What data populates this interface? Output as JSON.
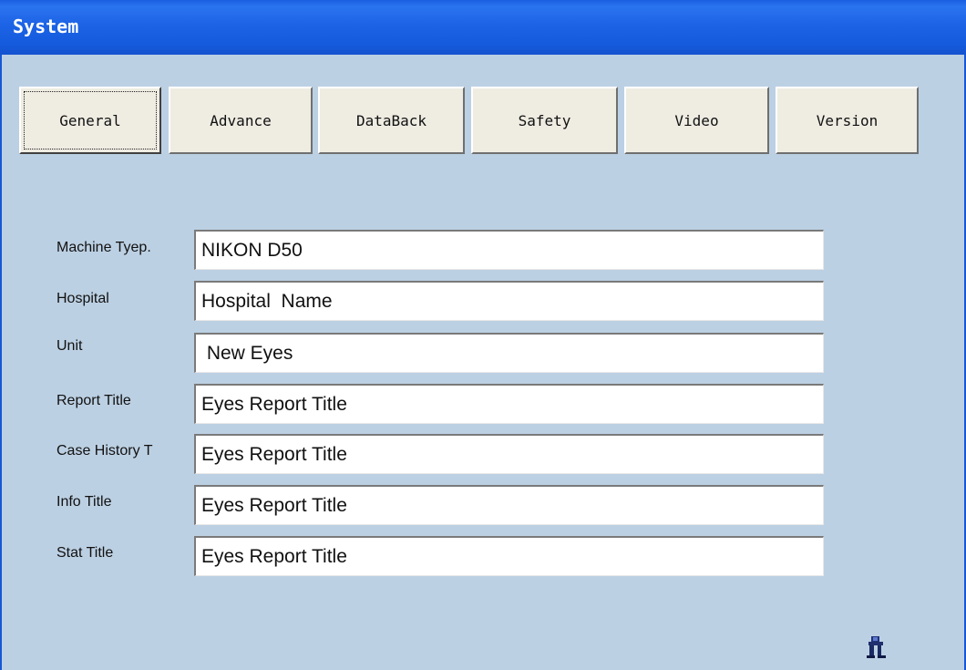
{
  "window": {
    "title": "System"
  },
  "tabs": [
    {
      "label": "General",
      "active": true
    },
    {
      "label": "Advance",
      "active": false
    },
    {
      "label": "DataBack",
      "active": false
    },
    {
      "label": "Safety",
      "active": false
    },
    {
      "label": "Video",
      "active": false
    },
    {
      "label": "Version",
      "active": false
    }
  ],
  "form": {
    "fields": [
      {
        "label": "Machine Tyep.",
        "value": "NIKON D50"
      },
      {
        "label": "Hospital",
        "value": "Hospital  Name"
      },
      {
        "label": "Unit",
        "value": " New Eyes"
      },
      {
        "label": "Report Title",
        "value": "Eyes Report Title"
      },
      {
        "label": "Case History T",
        "value": "Eyes Report Title"
      },
      {
        "label": "Info Title",
        "value": "Eyes Report Title"
      },
      {
        "label": "Stat Title",
        "value": "Eyes Report Title"
      }
    ]
  },
  "footer": {
    "exit_icon": "exit-door-icon"
  },
  "colors": {
    "titlebar": "#1c63e6",
    "background": "#bcd0e3",
    "button_face": "#efece2"
  }
}
